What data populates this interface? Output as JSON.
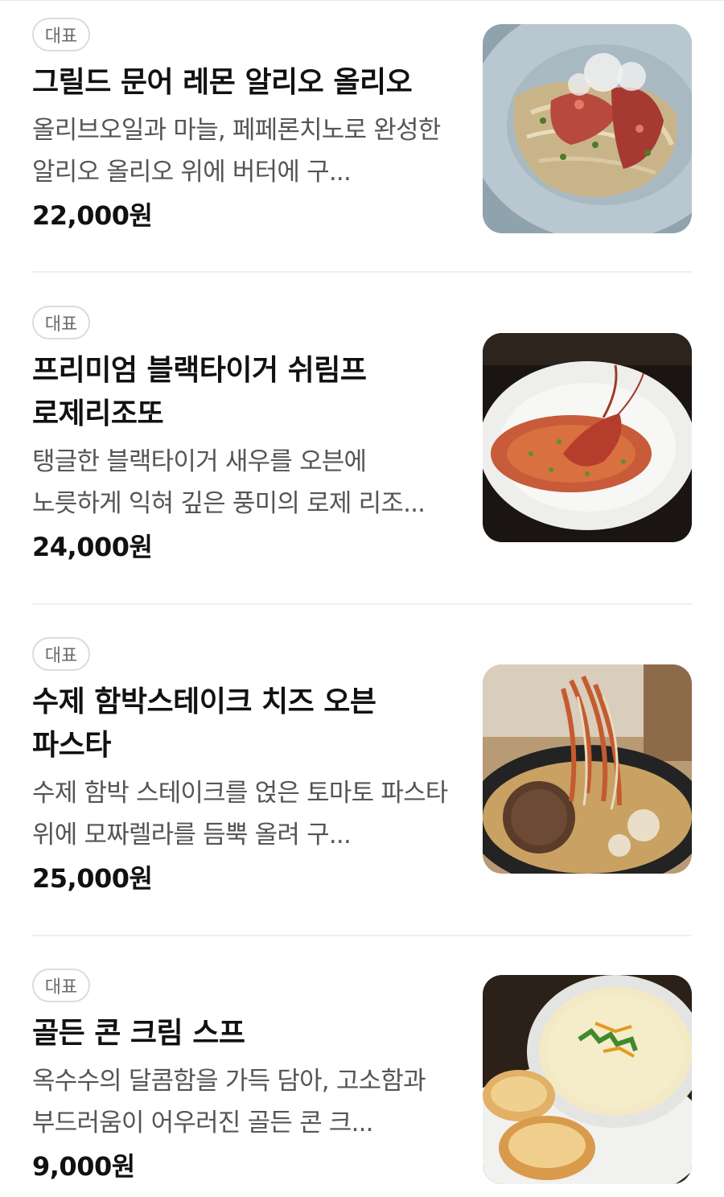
{
  "menu": {
    "items": [
      {
        "badge": "대표",
        "name": "그릴드 문어 레몬 알리오 올리오",
        "description": "올리브오일과 마늘, 페페론치노로 완성한 알리오 올리오 위에 버터에 구...",
        "price": "22,000원",
        "image_icon": "octopus-pasta-photo"
      },
      {
        "badge": "대표",
        "name": "프리미엄 블랙타이거 쉬림프 로제리조또",
        "description": "탱글한 블랙타이거 새우를 오븐에 노릇하게 익혀 깊은 풍미의 로제 리조...",
        "price": "24,000원",
        "image_icon": "shrimp-risotto-photo"
      },
      {
        "badge": "대표",
        "name": "수제 함박스테이크 치즈 오븐 파스타",
        "description": "수제 함박 스테이크를 얹은 토마토 파스타 위에 모짜렐라를 듬뿍 올려 구...",
        "price": "25,000원",
        "image_icon": "hamburg-steak-pasta-photo"
      },
      {
        "badge": "대표",
        "name": "골든 콘 크림 스프",
        "description": "옥수수의 달콤함을 가득 담아, 고소함과 부드러움이 어우러진 골든 콘 크...",
        "price": "9,000원",
        "image_icon": "corn-soup-photo"
      }
    ]
  },
  "colors": {
    "text_primary": "#111111",
    "text_secondary": "#555555",
    "badge_border": "#dcdcdc",
    "divider": "#efefef"
  }
}
